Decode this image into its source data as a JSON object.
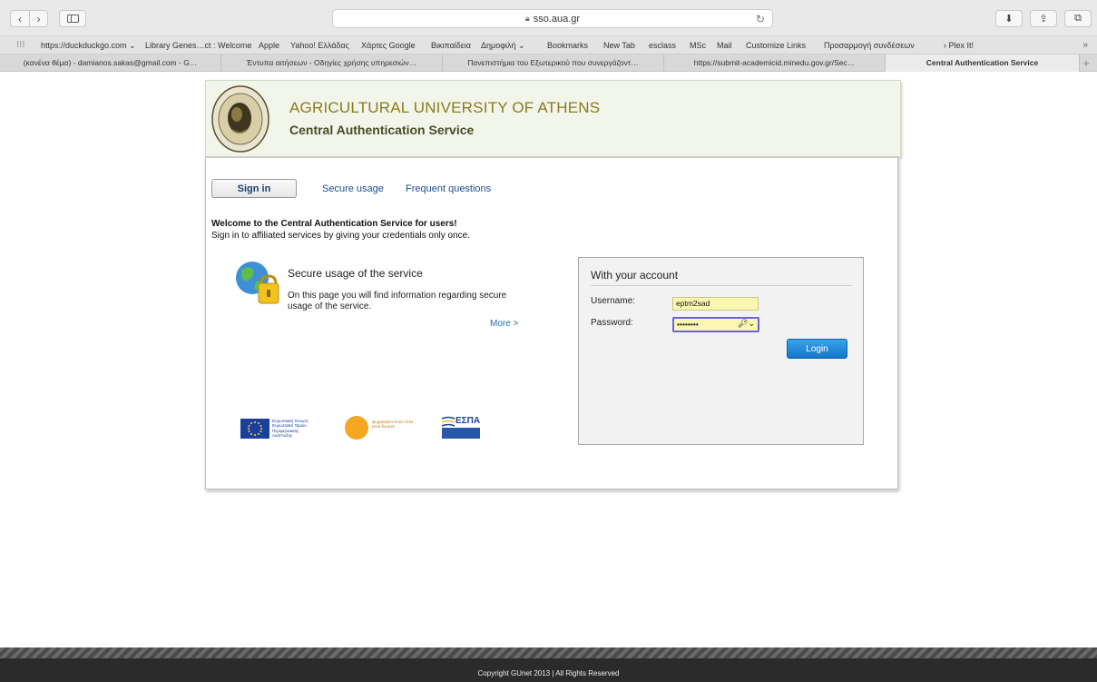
{
  "browser": {
    "url": "sso.aua.gr",
    "bookmarks": [
      "https://duckduckgo.com ⌄",
      "Library Genes…ct : Welcome",
      "Apple",
      "Yahoo! Ελλάδας",
      "Χάρτες Google",
      "Βικιπαίδεια",
      "Δημοφιλή ⌄",
      "Bookmarks",
      "New Tab",
      "esclass",
      "MSc",
      "Mail",
      "Customize Links",
      "Προσαρμογή συνδέσεων",
      "› Plex It!"
    ],
    "bookmarks_more": "»",
    "tabs": [
      "(κανένα θέμα) - damianos.sakas@gmail.com - G…",
      "Έντυπα αιτήσεων - Οδηγίες χρήσης υπηρεσιών…",
      "Πανεπιστήμια του Εξωτερικού που συνεργάζοντ…",
      "https://submit-academicid.minedu.gov.gr/Sec…",
      "Central Authentication Service"
    ],
    "new_tab": "+"
  },
  "header": {
    "university": "AGRICULTURAL UNIVERSITY OF ATHENS",
    "service": "Central Authentication Service"
  },
  "nav": {
    "signin": "Sign in",
    "secure": "Secure usage",
    "faq": "Frequent questions"
  },
  "welcome": {
    "line1": "Welcome to the Central Authentication Service for users!",
    "line2": "Sign in to affiliated services by giving your credentials only once."
  },
  "secure_block": {
    "title": "Secure usage of the service",
    "desc": "On this page you will find information regarding secure usage of the service.",
    "more": "More >"
  },
  "logos": {
    "eu": "Ευρωπαϊκή Ένωση Ευρωπαϊκό Ταμείο Περιφερειακής Ανάπτυξης",
    "digital": "ψηφιακήΕΛΛΑΔΑ Όλα είναι δυνατά",
    "espa": "ΕΣΠΑ"
  },
  "login": {
    "title": "With your account",
    "username_label": "Username:",
    "username_value": "eptm2sad",
    "password_label": "Password:",
    "password_value": "••••••••",
    "button": "Login"
  },
  "footer": {
    "text": "Copyright GUnet 2013 | All Rights Reserved"
  }
}
